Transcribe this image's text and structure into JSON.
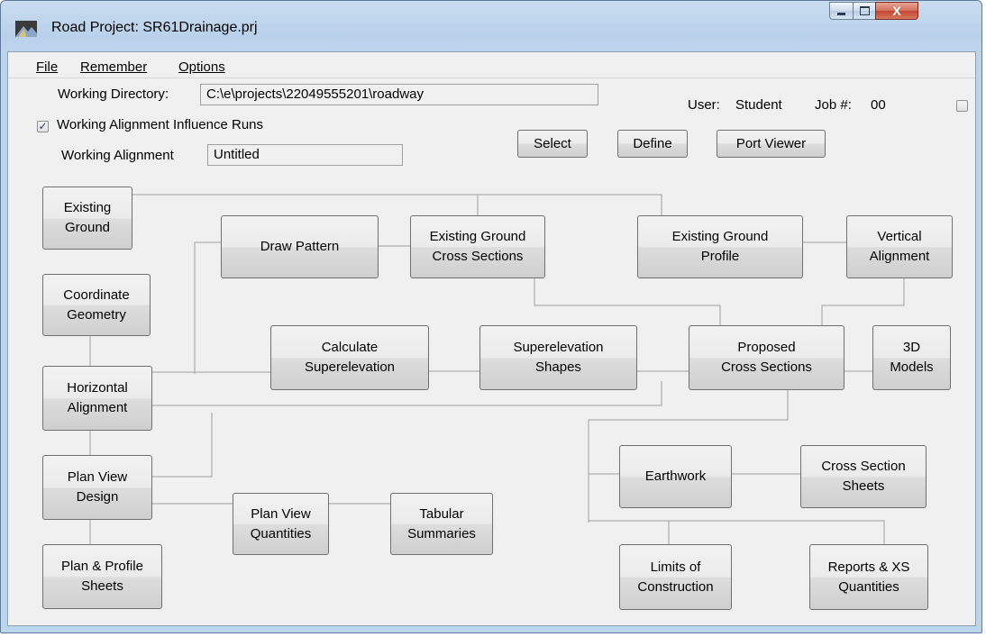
{
  "window": {
    "title": "Road Project: SR61Drainage.prj",
    "close_glyph": "X"
  },
  "menu": [
    "File",
    "Remember",
    "Options"
  ],
  "form": {
    "working_directory_label": "Working Directory:",
    "working_directory_value": "C:\\e\\projects\\22049555201\\roadway",
    "influence_label": "Working Alignment Influence Runs",
    "influence_checked": true,
    "working_alignment_label": "Working Alignment",
    "working_alignment_value": "Untitled",
    "user_label": "User:",
    "user_value": "Student",
    "job_label": "Job #:",
    "job_value": "00",
    "select_button": "Select",
    "define_button": "Define",
    "port_viewer_button": "Port Viewer"
  },
  "nodes": {
    "existing_ground": "Existing\nGround",
    "coordinate_geometry": "Coordinate\nGeometry",
    "horizontal_alignment": "Horizontal\nAlignment",
    "plan_view_design": "Plan View\nDesign",
    "plan_profile_sheets": "Plan & Profile\nSheets",
    "draw_pattern": "Draw Pattern",
    "existing_ground_cross_sections": "Existing Ground\nCross Sections",
    "existing_ground_profile": "Existing Ground\nProfile",
    "vertical_alignment": "Vertical\nAlignment",
    "calculate_superelevation": "Calculate\nSuperelevation",
    "superelevation_shapes": "Superelevation\nShapes",
    "proposed_cross_sections": "Proposed\nCross Sections",
    "models_3d": "3D\nModels",
    "plan_view_quantities": "Plan View\nQuantities",
    "tabular_summaries": "Tabular\nSummaries",
    "earthwork": "Earthwork",
    "cross_section_sheets": "Cross Section\nSheets",
    "limits_of_construction": "Limits of\nConstruction",
    "reports_xs_quantities": "Reports & XS\nQuantities"
  },
  "colors": {
    "frame": "#bcd4ec",
    "client": "#f0f0f0",
    "connector": "#a0a0a0",
    "close_button": "#c3442e"
  }
}
